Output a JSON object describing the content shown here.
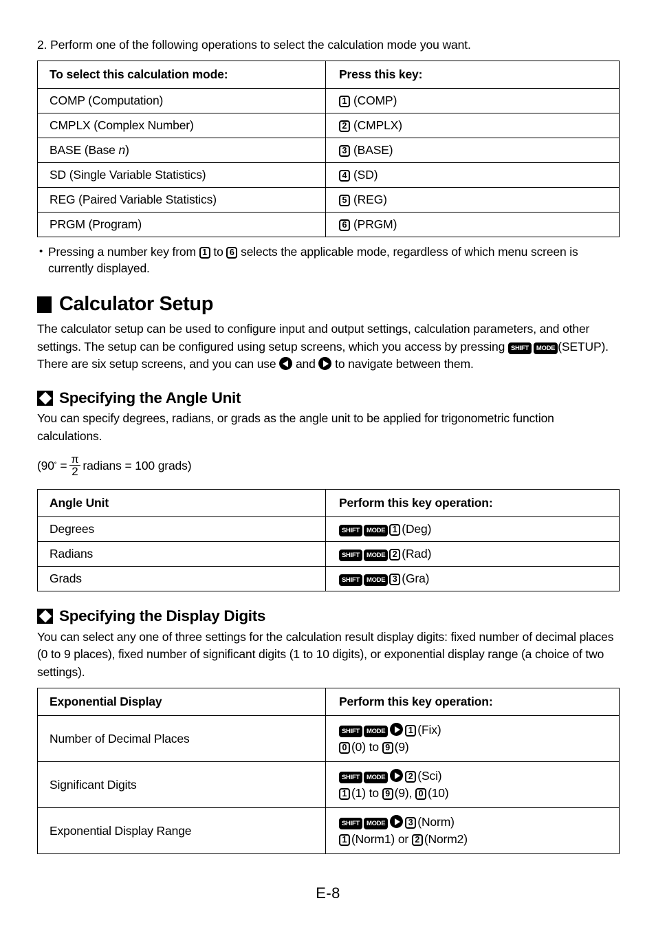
{
  "document": {
    "page_label": "E-8"
  },
  "step_instruction": "2. Perform one of the following operations to select the calculation mode you want.",
  "mode_table": {
    "headers": [
      "To select this calculation mode:",
      "Press this key:"
    ],
    "rows": [
      {
        "mode": "COMP (Computation)",
        "key": "1",
        "key_label": "(COMP)"
      },
      {
        "mode": "CMPLX (Complex Number)",
        "key": "2",
        "key_label": "(CMPLX)"
      },
      {
        "mode_pre": "BASE (Base ",
        "mode_italic": "n",
        "mode_post": ")",
        "key": "3",
        "key_label": "(BASE)"
      },
      {
        "mode": "SD (Single Variable Statistics)",
        "key": "4",
        "key_label": "(SD)"
      },
      {
        "mode": "REG (Paired Variable Statistics)",
        "key": "5",
        "key_label": "(REG)"
      },
      {
        "mode": "PRGM (Program)",
        "key": "6",
        "key_label": "(PRGM)"
      }
    ]
  },
  "mode_note": {
    "bullet": "•",
    "part1": "Pressing a number key from",
    "key_from": "1",
    "part2": "to",
    "key_to": "6",
    "part3": "selects the applicable mode, regardless of which menu screen is currently displayed."
  },
  "calculator_setup": {
    "heading": "Calculator Setup",
    "para_part1": "The calculator setup can be used to configure input and output settings, calculation parameters, and other settings.  The setup can be configured using setup screens, which you access by pressing",
    "key_shift": "SHIFT",
    "key_mode": "MODE",
    "para_part2": "(SETUP). There are six setup screens, and you can use",
    "para_part3": "and",
    "para_part4": "to navigate between them.",
    "icon_left": "arrow-left-key-icon",
    "icon_right": "arrow-right-key-icon"
  },
  "angle_unit_section": {
    "heading": "Specifying the Angle Unit",
    "para": "You can specify degrees, radians, or grads as the angle unit to be applied for trigonometric function calculations.",
    "formula": {
      "prefix": "(90",
      "degree_symbol": "˚",
      "equals": "=",
      "numerator": "π",
      "denominator": "2",
      "middle": "radians = 100 grads)"
    },
    "table": {
      "headers": [
        "Angle Unit",
        "Perform this key operation:"
      ],
      "rows": [
        {
          "unit": "Degrees",
          "keys": [
            "SHIFT",
            "MODE",
            "1"
          ],
          "label": "(Deg)"
        },
        {
          "unit": "Radians",
          "keys": [
            "SHIFT",
            "MODE",
            "2"
          ],
          "label": "(Rad)"
        },
        {
          "unit": "Grads",
          "keys": [
            "SHIFT",
            "MODE",
            "3"
          ],
          "label": "(Gra)"
        }
      ]
    }
  },
  "display_digits_section": {
    "heading": "Specifying the Display Digits",
    "para": "You can select any one of three settings for the calculation result display digits: fixed number of decimal places (0 to 9 places), fixed number of significant digits (1 to 10 digits), or exponential display range (a choice of two settings).",
    "table": {
      "headers": [
        "Exponential Display",
        "Perform this key operation:"
      ],
      "rows": [
        {
          "item": "Number of Decimal Places",
          "line1": {
            "shift": "SHIFT",
            "mode": "MODE",
            "arrow": "arrow-right-key-icon",
            "digit": "1",
            "label": "(Fix)"
          },
          "line2": {
            "k1": "0",
            "l1": "(0) to",
            "k2": "9",
            "l2": "(9)"
          }
        },
        {
          "item": "Significant Digits",
          "line1": {
            "shift": "SHIFT",
            "mode": "MODE",
            "arrow": "arrow-right-key-icon",
            "digit": "2",
            "label": "(Sci)"
          },
          "line2": {
            "k1": "1",
            "l1": "(1) to",
            "k2": "9",
            "l2": "(9),",
            "k3": "0",
            "l3": "(10)"
          }
        },
        {
          "item": "Exponential Display Range",
          "line1": {
            "shift": "SHIFT",
            "mode": "MODE",
            "arrow": "arrow-right-key-icon",
            "digit": "3",
            "label": "(Norm)"
          },
          "line2": {
            "k1": "1",
            "l1": "(Norm1) or",
            "k2": "2",
            "l2": "(Norm2)"
          }
        }
      ]
    }
  }
}
